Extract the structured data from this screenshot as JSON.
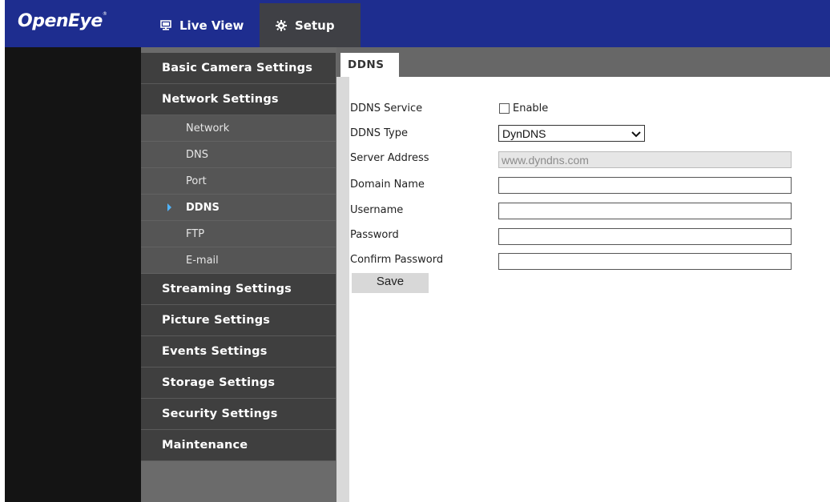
{
  "brand": {
    "logo_text": "OpenEye",
    "logo_mark": "®"
  },
  "nav": {
    "live_view": "Live View",
    "setup": "Setup"
  },
  "sidebar": {
    "categories_top": [
      {
        "label": "Basic Camera Settings"
      },
      {
        "label": "Network Settings"
      }
    ],
    "network_sub": [
      {
        "label": "Network"
      },
      {
        "label": "DNS"
      },
      {
        "label": "Port"
      },
      {
        "label": "DDNS",
        "active": true
      },
      {
        "label": "FTP"
      },
      {
        "label": "E-mail"
      }
    ],
    "categories_bottom": [
      {
        "label": "Streaming Settings"
      },
      {
        "label": "Picture Settings"
      },
      {
        "label": "Events Settings"
      },
      {
        "label": "Storage Settings"
      },
      {
        "label": "Security Settings"
      },
      {
        "label": "Maintenance"
      }
    ]
  },
  "content": {
    "tab": "DDNS",
    "labels": {
      "ddns_service": "DDNS Service",
      "ddns_type": "DDNS Type",
      "server_address": "Server Address",
      "domain_name": "Domain Name",
      "username": "Username",
      "password": "Password",
      "confirm_password": "Confirm Password"
    },
    "enable_label": "Enable",
    "ddns_type_value": "DynDNS",
    "server_address_value": "www.dyndns.com",
    "domain_name_value": "",
    "username_value": "",
    "password_value": "",
    "confirm_password_value": "",
    "save_label": "Save"
  },
  "colors": {
    "topbar": "#1e2d8f",
    "setup_tab": "#3f4045",
    "sidebar_bg": "#3f3f3f",
    "sub_bg": "#555555",
    "active_arrow": "#4fb4ff"
  }
}
